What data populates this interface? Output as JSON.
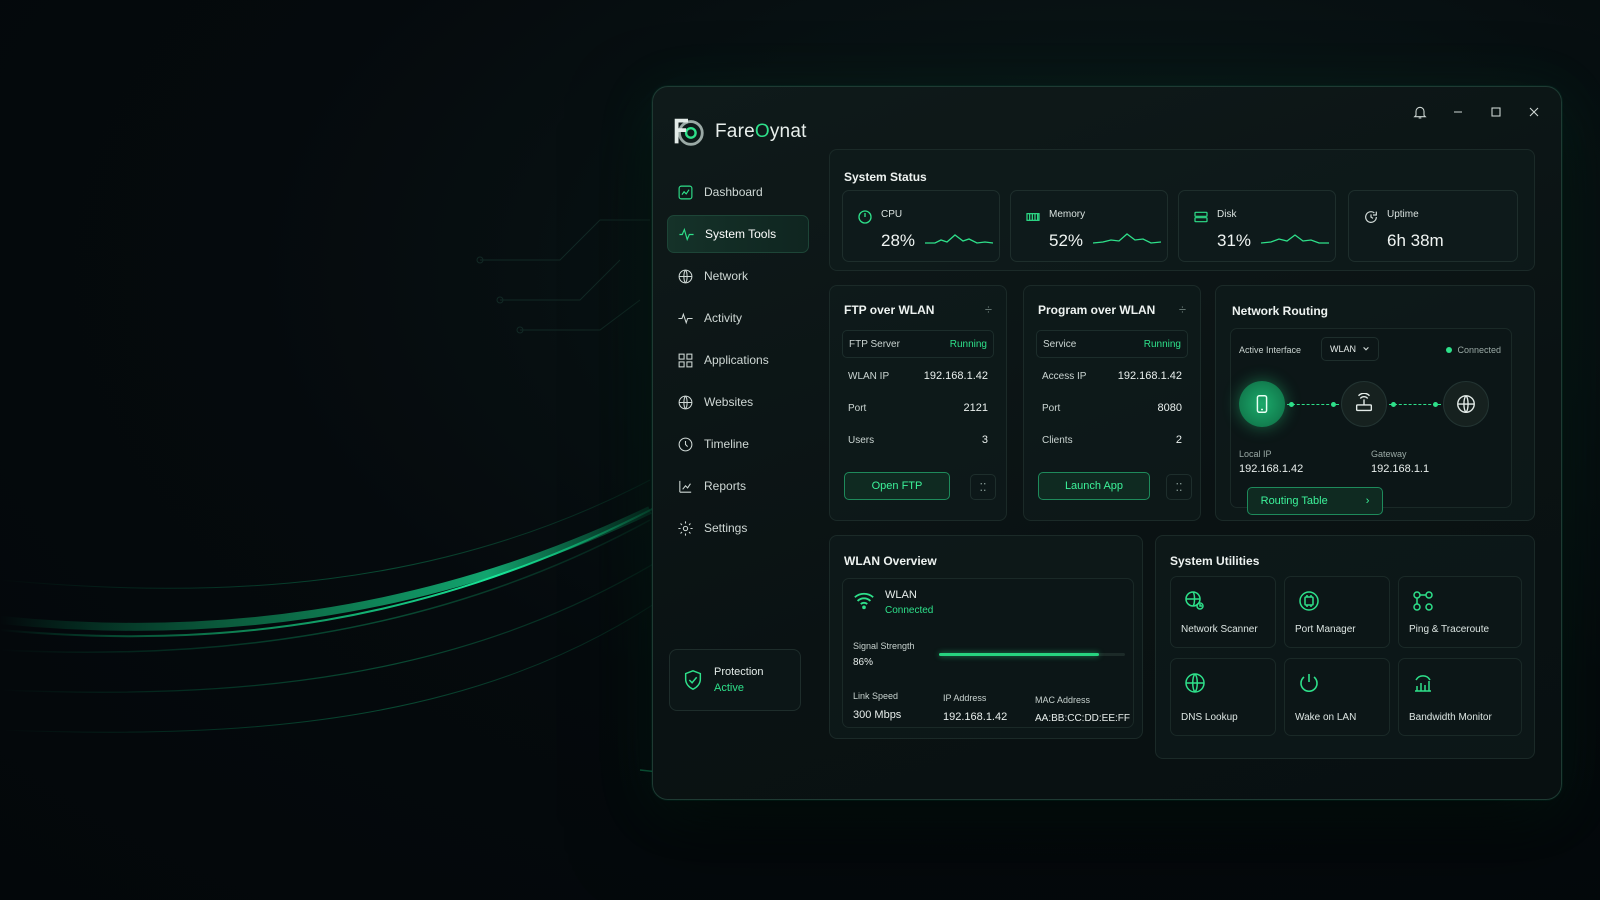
{
  "app": {
    "name_prefix": "Fare",
    "name_accent": "O",
    "name_suffix": "ynat"
  },
  "sidebar": {
    "items": [
      {
        "label": "Dashboard",
        "icon": "dashboard-icon"
      },
      {
        "label": "System Tools",
        "icon": "pulse-icon",
        "active": true
      },
      {
        "label": "Network",
        "icon": "globe-icon"
      },
      {
        "label": "Activity",
        "icon": "activity-icon"
      },
      {
        "label": "Applications",
        "icon": "grid-icon"
      },
      {
        "label": "Websites",
        "icon": "globe-icon"
      },
      {
        "label": "Timeline",
        "icon": "clock-icon"
      },
      {
        "label": "Reports",
        "icon": "report-icon"
      },
      {
        "label": "Settings",
        "icon": "gear-icon"
      }
    ],
    "protection": {
      "title": "Protection",
      "status": "Active"
    }
  },
  "system_status": {
    "title": "System Status",
    "cpu": {
      "label": "CPU",
      "value": "28%"
    },
    "memory": {
      "label": "Memory",
      "value": "52%"
    },
    "disk": {
      "label": "Disk",
      "value": "31%"
    },
    "uptime": {
      "label": "Uptime",
      "value": "6h 38m"
    }
  },
  "ftp": {
    "title": "FTP over WLAN",
    "rows": [
      {
        "k": "FTP Server",
        "v": "Running"
      },
      {
        "k": "WLAN IP",
        "v": "192.168.1.42"
      },
      {
        "k": "Port",
        "v": "2121"
      },
      {
        "k": "Users",
        "v": "3"
      }
    ],
    "button": "Open FTP"
  },
  "program": {
    "title": "Program over WLAN",
    "rows": [
      {
        "k": "Service",
        "v": "Running"
      },
      {
        "k": "Access IP",
        "v": "192.168.1.42"
      },
      {
        "k": "Port",
        "v": "8080"
      },
      {
        "k": "Clients",
        "v": "2"
      }
    ],
    "button": "Launch App"
  },
  "routing": {
    "title": "Network Routing",
    "active_interface_label": "Active Interface",
    "active_interface_value": "WLAN",
    "status": "Connected",
    "local_ip_label": "Local IP",
    "local_ip": "192.168.1.42",
    "gateway_label": "Gateway",
    "gateway": "192.168.1.1",
    "button": "Routing Table"
  },
  "wlan": {
    "title": "WLAN Overview",
    "name": "WLAN",
    "status": "Connected",
    "signal_label": "Signal Strength",
    "signal_value": "86%",
    "signal_fraction": 0.86,
    "link_speed_label": "Link Speed",
    "link_speed": "300 Mbps",
    "ip_label": "IP Address",
    "ip": "192.168.1.42",
    "mac_label": "MAC Address",
    "mac": "AA:BB:CC:DD:EE:FF"
  },
  "utilities": {
    "title": "System Utilities",
    "items": [
      {
        "label": "Network Scanner",
        "icon": "network-scanner-icon"
      },
      {
        "label": "Port Manager",
        "icon": "port-manager-icon"
      },
      {
        "label": "Ping & Traceroute",
        "icon": "ping-icon"
      },
      {
        "label": "DNS Lookup",
        "icon": "dns-icon"
      },
      {
        "label": "Wake on LAN",
        "icon": "power-icon"
      },
      {
        "label": "Bandwidth Monitor",
        "icon": "bandwidth-icon"
      }
    ]
  },
  "colors": {
    "accent": "#2ee08a",
    "background": "#050a0d",
    "panel": "#0c1617"
  }
}
